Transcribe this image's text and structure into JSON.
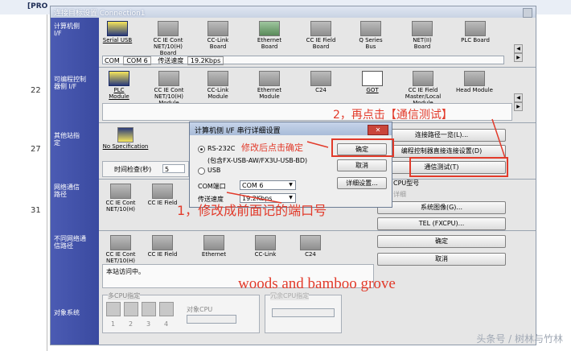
{
  "background": {
    "title": "[PRO",
    "line_numbers": [
      "22",
      "27",
      "31"
    ]
  },
  "window": {
    "title": "连接目标设置 Connection1"
  },
  "sections": {
    "pc_side": "计算机侧 I/F",
    "plc_side": "可编程控制器侧 I/F",
    "other_station": "其他站指定",
    "network": "网络通信路径",
    "diff_network": "不同网络通信路径",
    "target_system": "对象系统"
  },
  "pc_icons": [
    "Serial USB",
    "CC IE Cont NET/10(H) Board",
    "CC-Link Board",
    "Ethernet Board",
    "CC IE Field Board",
    "Q Series Bus",
    "NET(II) Board",
    "PLC Board"
  ],
  "com_line": {
    "com_label": "COM",
    "com_value": "COM 6",
    "speed_label": "传送速度",
    "speed_value": "19.2Kbps"
  },
  "plc_icons": [
    "PLC Module",
    "CC IE Cont NET/10(H) Module",
    "CC-Link Module",
    "Ethernet Module",
    "C24",
    "GOT",
    "CC IE Field Master/Local Module",
    "Head Module"
  ],
  "other_station": {
    "icon_label": "No Specification"
  },
  "time_check": {
    "label": "时间检查(秒)",
    "value": "5"
  },
  "network_icons": [
    "CC IE Cont NET/10(H)",
    "CC IE Field"
  ],
  "diff_network_icons": [
    "CC IE Cont NET/10(H)",
    "CC IE Field",
    "Ethernet",
    "CC-Link",
    "C24"
  ],
  "station_access": "本站访问中。",
  "multi_cpu": {
    "label": "多CPU指定",
    "numbers": [
      "1",
      "2",
      "3",
      "4"
    ],
    "target_cpu": "对象CPU"
  },
  "redundant": {
    "label": "冗余CPU指定"
  },
  "right_buttons": {
    "route_list": "连接路径一览(L)...",
    "direct_connect": "编程控制器直接连接设置(D)",
    "comm_test": "通信测试(T)",
    "cpu_model_label": "CPU型号",
    "detail_label": "详细",
    "system_image": "系统图像(G)...",
    "tel": "TEL (FXCPU)...",
    "ok": "确定",
    "cancel": "取消"
  },
  "dialog": {
    "title": "计算机侧 I/F 串行详细设置",
    "rs232c": "RS-232C",
    "rs232c_note": "(包含FX-USB-AW/FX3U-USB-BD)",
    "usb": "USB",
    "com_port_label": "COM端口",
    "com_port_value": "COM 6",
    "speed_label": "传送速度",
    "speed_value": "19.2Kbps",
    "ok": "确定",
    "cancel": "取消",
    "detail": "详细设置..."
  },
  "annotations": {
    "step1": "1，修改成前面记的端口号",
    "step2": "2，再点击【通信测试】",
    "modify_hint": "修改后点击确定",
    "watermark_caption": "woods and bamboo grove",
    "source": "头条号 / 树林与竹林",
    "color": "#e23a2a"
  }
}
